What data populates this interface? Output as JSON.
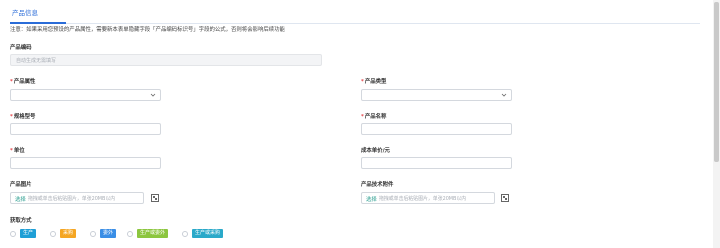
{
  "tab": {
    "label": "产品信息"
  },
  "note": "注意：如果采用您预设的产品属性，需要新本表单隐藏字段「产品编码标识号」字段的公式，否则将会影响后续功能",
  "fields": {
    "code": {
      "label": "产品编码",
      "placeholder": "自动生成无需填写"
    },
    "attribute": {
      "label": "产品属性",
      "required": "*"
    },
    "type": {
      "label": "产品类型",
      "required": "*"
    },
    "model": {
      "label": "规格型号",
      "required": "*"
    },
    "name": {
      "label": "产品名称",
      "required": "*"
    },
    "unit": {
      "label": "单位",
      "required": "*"
    },
    "cost": {
      "label": "成本单价/元"
    },
    "image": {
      "label": "产品图片",
      "button": "选择",
      "hint": "拖拽或单击后粘贴图片，单张20MB以内"
    },
    "attachment": {
      "label": "产品技术附件",
      "button": "选择",
      "hint": "拖拽或单击后粘贴图片，单张20MB以内"
    }
  },
  "acquisition": {
    "label": "获取方式",
    "options": [
      {
        "label": "生产",
        "color": "#1f9fd6"
      },
      {
        "label": "采购",
        "color": "#f5a623"
      },
      {
        "label": "委外",
        "color": "#3a8ee6"
      },
      {
        "label": "生产或委外",
        "color": "#8cc63f"
      },
      {
        "label": "生产或采购",
        "color": "#2aa9c9"
      }
    ]
  },
  "icons": {
    "chevron": "chevron-down-icon",
    "qr": "qr-code-icon"
  }
}
